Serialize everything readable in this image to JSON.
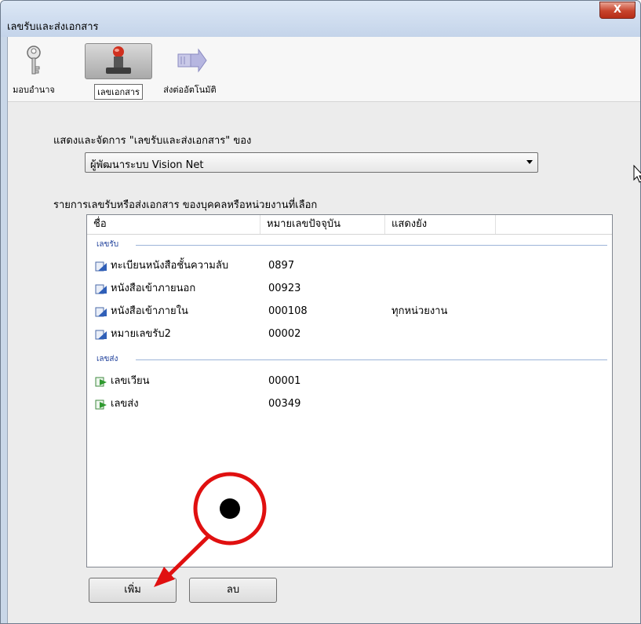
{
  "window": {
    "title": "เลขรับและส่งเอกสาร",
    "close_label": "X"
  },
  "toolbar": {
    "items": [
      {
        "label": "มอบอำนาจ",
        "icon": "key-icon",
        "selected": false
      },
      {
        "label": "เลขเอกสาร",
        "icon": "stamp-icon",
        "selected": true
      },
      {
        "label": "ส่งต่ออัตโนมัติ",
        "icon": "forward-arrow-icon",
        "selected": false
      }
    ]
  },
  "form": {
    "owner_label": "แสดงและจัดการ \"เลขรับและส่งเอกสาร\" ของ",
    "owner_value": "ผู้พัฒนาระบบ Vision Net",
    "list_label": "รายการเลขรับหรือส่งเอกสาร ของบุคคลหรือหน่วยงานที่เลือก"
  },
  "table": {
    "columns": [
      "ชื่อ",
      "หมายเลขปัจจุบัน",
      "แสดงยัง"
    ],
    "groups": [
      {
        "name": "เลขรับ",
        "rows": [
          {
            "name": "ทะเบียนหนังสือชั้นความลับ",
            "number": "0897",
            "show": ""
          },
          {
            "name": "หนังสือเข้าภายนอก",
            "number": "00923",
            "show": ""
          },
          {
            "name": "หนังสือเข้าภายใน",
            "number": "000108",
            "show": "ทุกหน่วยงาน"
          },
          {
            "name": "หมายเลขรับ2",
            "number": "00002",
            "show": ""
          }
        ]
      },
      {
        "name": "เลขส่ง",
        "rows": [
          {
            "name": "เลขเวียน",
            "number": "00001",
            "show": ""
          },
          {
            "name": "เลขส่ง",
            "number": "00349",
            "show": ""
          }
        ]
      }
    ]
  },
  "buttons": {
    "add": "เพิ่ม",
    "delete": "ลบ"
  },
  "colors": {
    "incoming_icon": "#2f5fb8",
    "outgoing_icon": "#2f9a2f",
    "annotation": "#e01010"
  }
}
